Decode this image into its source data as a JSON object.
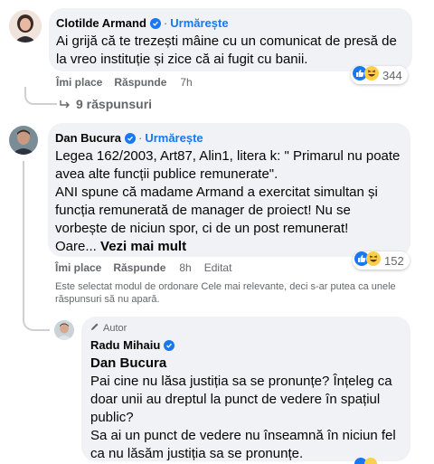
{
  "comments": [
    {
      "author": "Clotilde Armand",
      "follow_label": "Urmărește",
      "lines": [
        "Ai grijă că te trezești mâine cu un comunicat de presă de",
        "la vreo instituție și zice că ai fugit cu banii."
      ],
      "like_label": "Îmi place",
      "reply_label": "Răspunde",
      "time": "7h",
      "reaction_count": "344",
      "replies_label": "9 răspunsuri"
    },
    {
      "author": "Dan Bucura",
      "follow_label": "Urmărește",
      "lines": [
        "Legea 162/2003, Art87, Alin1, litera k: \" Primarul nu poate",
        "avea alte funcții publice remunerate\".",
        "ANI spune că madame Armand a exercitat simultan și",
        "funcția remunerată de manager de proiect! Nu se",
        "vorbește de niciun spor, ci de un post remunerat!"
      ],
      "last_line_prefix": "Oare...",
      "see_more": "Vezi mai mult",
      "like_label": "Îmi place",
      "reply_label": "Răspunde",
      "time": "8h",
      "edited_label": "Editat",
      "reaction_count": "152"
    }
  ],
  "sort_notice": "Este selectat modul de ordonare Cele mai relevante, deci s-ar putea ca unele răspunsuri să nu apară.",
  "reply": {
    "badge": "Autor",
    "author": "Radu Mihaiu",
    "mention": "Dan Bucura",
    "lines": [
      "Pai cine nu lăsa justiția sa se pronunțe? Înțeleg ca",
      "doar unii au dreptul la punct de vedere în spațiul",
      "public?",
      "Sa ai un punct de vedere nu înseamnă în niciun fel",
      "ca nu lăsăm justiția sa se pronunțe."
    ]
  },
  "colors": {
    "accent": "#1877f2",
    "bubble": "#f0f2f5",
    "muted": "#65676b"
  },
  "icons": [
    "verified-badge-icon",
    "like-reaction-icon",
    "haha-reaction-icon",
    "reply-arrow-icon",
    "author-pen-icon"
  ]
}
